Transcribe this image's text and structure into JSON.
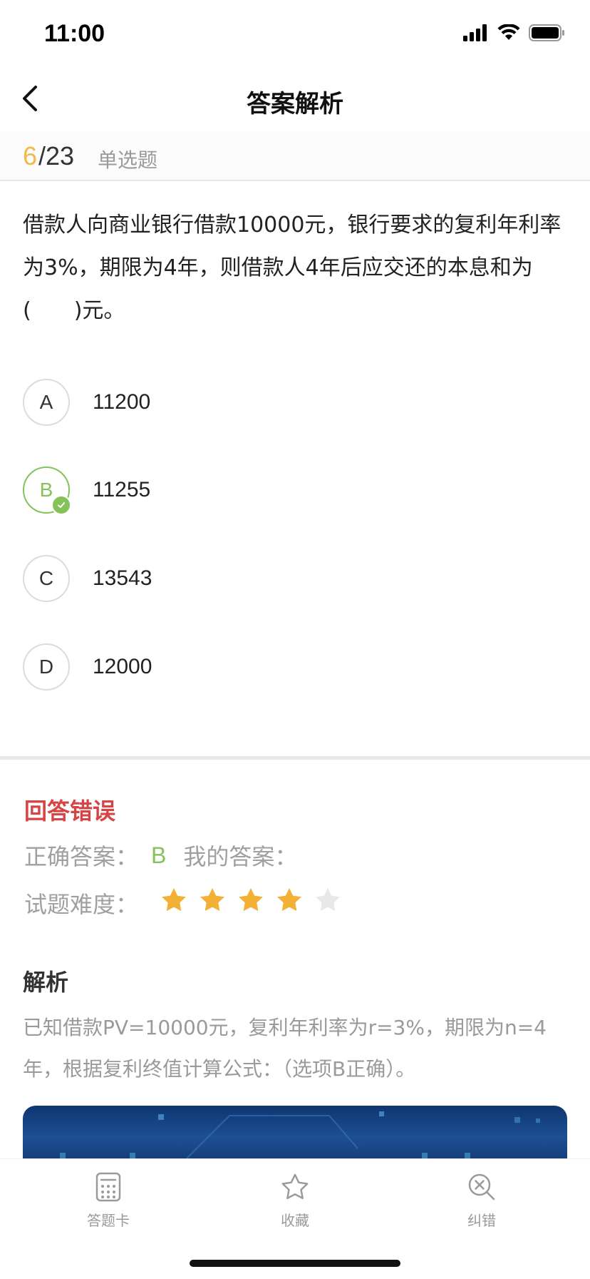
{
  "status_bar": {
    "time": "11:00"
  },
  "nav": {
    "title": "答案解析",
    "back_icon": "chevron-left-icon"
  },
  "progress": {
    "current": "6",
    "total": "/23",
    "type": "单选题"
  },
  "question": {
    "text": "借款人向商业银行借款10000元，银行要求的复利年利率为3%，期限为4年，则借款人4年后应交还的本息和为(　　)元。"
  },
  "options": [
    {
      "letter": "A",
      "value": "11200",
      "correct": false
    },
    {
      "letter": "B",
      "value": "11255",
      "correct": true
    },
    {
      "letter": "C",
      "value": "13543",
      "correct": false
    },
    {
      "letter": "D",
      "value": "12000",
      "correct": false
    }
  ],
  "result": {
    "status": "回答错误",
    "correct_label": "正确答案：",
    "correct_value": "B",
    "my_answer_label": "我的答案：",
    "difficulty_label": "试题难度：",
    "difficulty_stars": 4,
    "difficulty_max": 5
  },
  "analysis": {
    "title": "解析",
    "text": "已知借款PV=10000元，复利年利率为r=3%，期限为n=4年，根据复利终值计算公式：（选项B正确）。"
  },
  "tabs": [
    {
      "label": "答题卡",
      "icon": "answer-card-icon"
    },
    {
      "label": "收藏",
      "icon": "star-outline-icon"
    },
    {
      "label": "纠错",
      "icon": "error-correction-icon"
    }
  ],
  "colors": {
    "accent_yellow": "#f0b948",
    "correct_green": "#86c25a",
    "wrong_red": "#d64545",
    "star_gold": "#f2b134",
    "star_empty": "#e8e8e8"
  }
}
